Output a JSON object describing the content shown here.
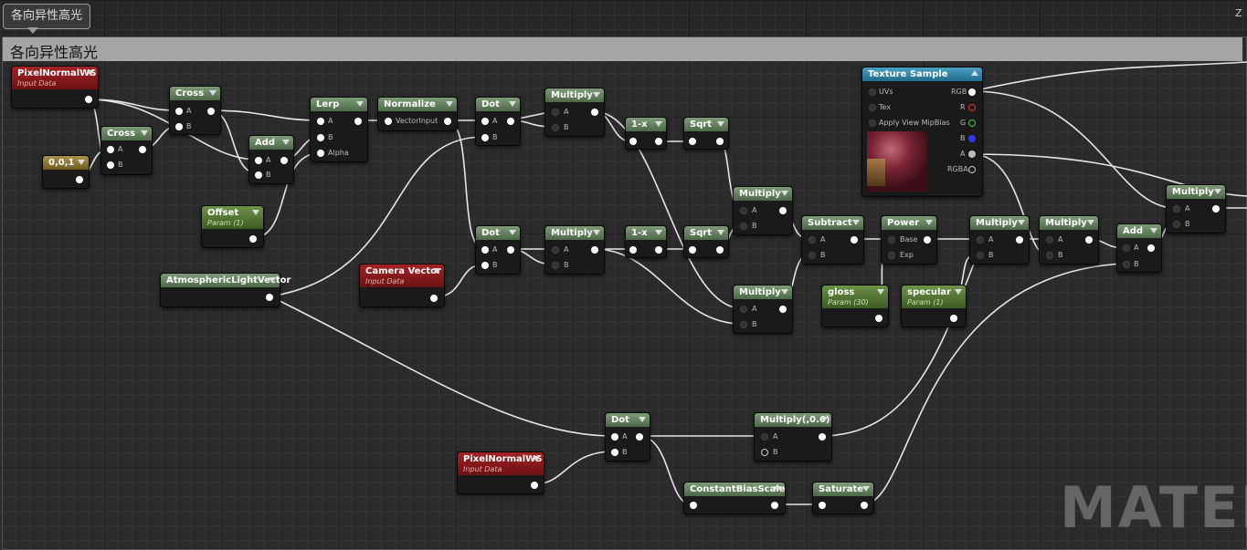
{
  "comment": {
    "bubble_label": "各向异性高光",
    "title": "各向异性高光"
  },
  "corner_hint": "Z",
  "watermark": "MATERI",
  "nodes": {
    "pixelnormal1": {
      "title": "PixelNormalWS",
      "subtitle": "Input Data"
    },
    "const001": {
      "title": "0,0,1"
    },
    "cross1": {
      "title": "Cross",
      "pins": [
        "A",
        "B"
      ]
    },
    "cross2": {
      "title": "Cross",
      "pins": [
        "A",
        "B"
      ]
    },
    "add1": {
      "title": "Add",
      "pins": [
        "A",
        "B"
      ]
    },
    "offset": {
      "title": "Offset",
      "subtitle": "Param (1)"
    },
    "lerp": {
      "title": "Lerp",
      "pins": [
        "A",
        "B",
        "Alpha"
      ]
    },
    "normalize": {
      "title": "Normalize",
      "pins": [
        "VectorInput"
      ]
    },
    "dot1": {
      "title": "Dot",
      "pins": [
        "A",
        "B"
      ]
    },
    "dot2": {
      "title": "Dot",
      "pins": [
        "A",
        "B"
      ]
    },
    "multiply1": {
      "title": "Multiply",
      "pins": [
        "A",
        "B"
      ]
    },
    "multiply2": {
      "title": "Multiply",
      "pins": [
        "A",
        "B"
      ]
    },
    "oneminus1": {
      "title": "1-x"
    },
    "oneminus2": {
      "title": "1-x"
    },
    "sqrt1": {
      "title": "Sqrt"
    },
    "sqrt2": {
      "title": "Sqrt"
    },
    "multiply3": {
      "title": "Multiply",
      "pins": [
        "A",
        "B"
      ]
    },
    "multiply4": {
      "title": "Multiply",
      "pins": [
        "A",
        "B"
      ]
    },
    "atmospheric": {
      "title": "AtmosphericLightVector"
    },
    "cameravector": {
      "title": "Camera Vector",
      "subtitle": "Input Data"
    },
    "subtract": {
      "title": "Subtract",
      "pins": [
        "A",
        "B"
      ]
    },
    "power": {
      "title": "Power",
      "pins": [
        "Base",
        "Exp"
      ]
    },
    "gloss": {
      "title": "gloss",
      "subtitle": "Param (30)"
    },
    "specular": {
      "title": "specular",
      "subtitle": "Param (1)"
    },
    "multiply5": {
      "title": "Multiply",
      "pins": [
        "A",
        "B"
      ]
    },
    "multiply6": {
      "title": "Multiply",
      "pins": [
        "A",
        "B"
      ]
    },
    "add2": {
      "title": "Add",
      "pins": [
        "A",
        "B"
      ]
    },
    "multiply7": {
      "title": "Multiply",
      "pins": [
        "A",
        "B"
      ]
    },
    "texsample": {
      "title": "Texture Sample",
      "inputs": [
        "UVs",
        "Tex",
        "Apply View MipBias"
      ],
      "outputs": [
        "RGB",
        "R",
        "G",
        "B",
        "A",
        "RGBA"
      ]
    },
    "dot3": {
      "title": "Dot",
      "pins": [
        "A",
        "B"
      ]
    },
    "pixelnormal2": {
      "title": "PixelNormalWS",
      "subtitle": "Input Data"
    },
    "multiply06": {
      "title": "Multiply(,0.6)",
      "pins": [
        "A",
        "B"
      ]
    },
    "cbs": {
      "title": "ConstantBiasScale"
    },
    "saturate": {
      "title": "Saturate"
    }
  },
  "colors": {
    "wire": "#e6e6e6",
    "pin_r": "#e33",
    "pin_g": "#3c3",
    "pin_b": "#33e"
  }
}
